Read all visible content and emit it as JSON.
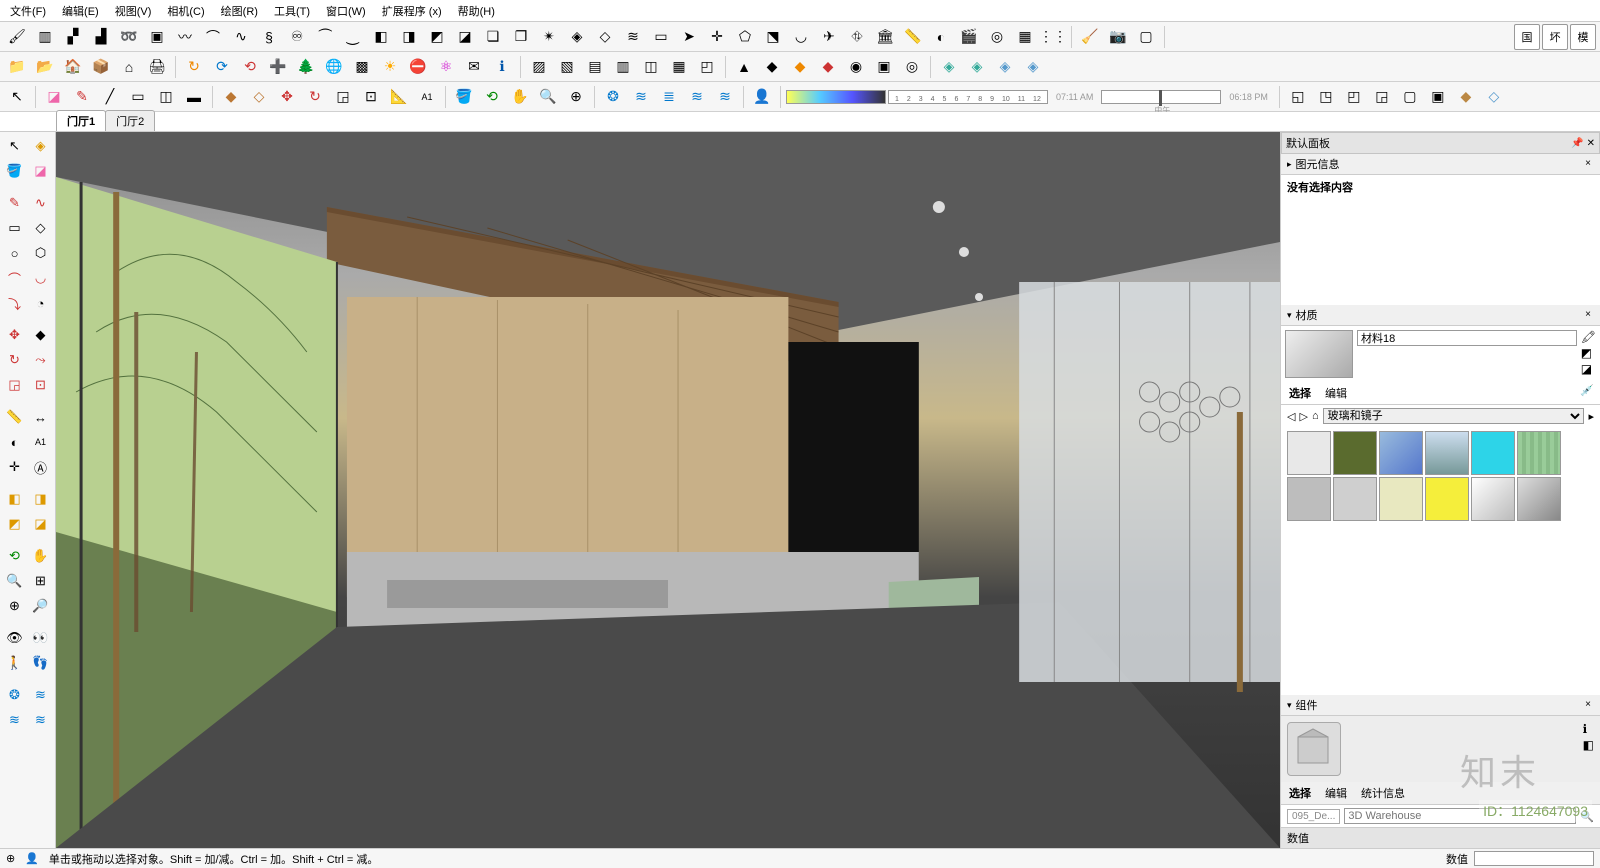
{
  "menu": {
    "items": [
      "文件(F)",
      "编辑(E)",
      "视图(V)",
      "相机(C)",
      "绘图(R)",
      "工具(T)",
      "窗口(W)",
      "扩展程序 (x)",
      "帮助(H)"
    ]
  },
  "scene_tabs": {
    "tabs": [
      "门厅1",
      "门厅2"
    ],
    "active": 0
  },
  "ruler_numbers": [
    "1",
    "2",
    "3",
    "4",
    "5",
    "6",
    "7",
    "8",
    "9",
    "10",
    "11",
    "12"
  ],
  "time": {
    "start": "07:11 AM",
    "noon_label": "中午",
    "end": "06:18 PM"
  },
  "right_bg_buttons": [
    "国",
    "坏",
    "模"
  ],
  "right_panel": {
    "default_tray": "默认面板",
    "entity_info": {
      "title": "图元信息",
      "empty_msg": "没有选择内容"
    },
    "materials": {
      "title": "材质",
      "current_name": "材料18",
      "tabs": [
        "选择",
        "编辑"
      ],
      "library_name": "玻璃和镜子",
      "swatches": [
        {
          "bg": "#e8e8e8"
        },
        {
          "bg": "#5a6b2e"
        },
        {
          "bg": "linear-gradient(135deg,#9bd,#57c)"
        },
        {
          "bg": "linear-gradient(180deg,#cde,#799)"
        },
        {
          "bg": "#2dd4e8"
        },
        {
          "bg": "repeating-linear-gradient(90deg,#9c9 0 4px,#8b8 4px 8px)"
        },
        {
          "bg": "#bdbdbd"
        },
        {
          "bg": "#cfcfcf"
        },
        {
          "bg": "#e8e8c0"
        },
        {
          "bg": "#f5ee3b"
        },
        {
          "bg": "linear-gradient(135deg,#fff,#bbb)"
        },
        {
          "bg": "linear-gradient(135deg,#ddd,#888)"
        }
      ]
    },
    "components": {
      "title": "组件",
      "tabs": [
        "选择",
        "编辑",
        "统计信息"
      ],
      "filter_placeholder": "3D Warehouse",
      "sample_item": "095_De..."
    },
    "value_label": "数值"
  },
  "status": {
    "hint": "单击或拖动以选择对象。Shift = 加/减。Ctrl = 加。Shift + Ctrl = 减。",
    "value_label": "数值"
  },
  "watermark": {
    "logo": "知末",
    "id": "ID：1124647093"
  }
}
